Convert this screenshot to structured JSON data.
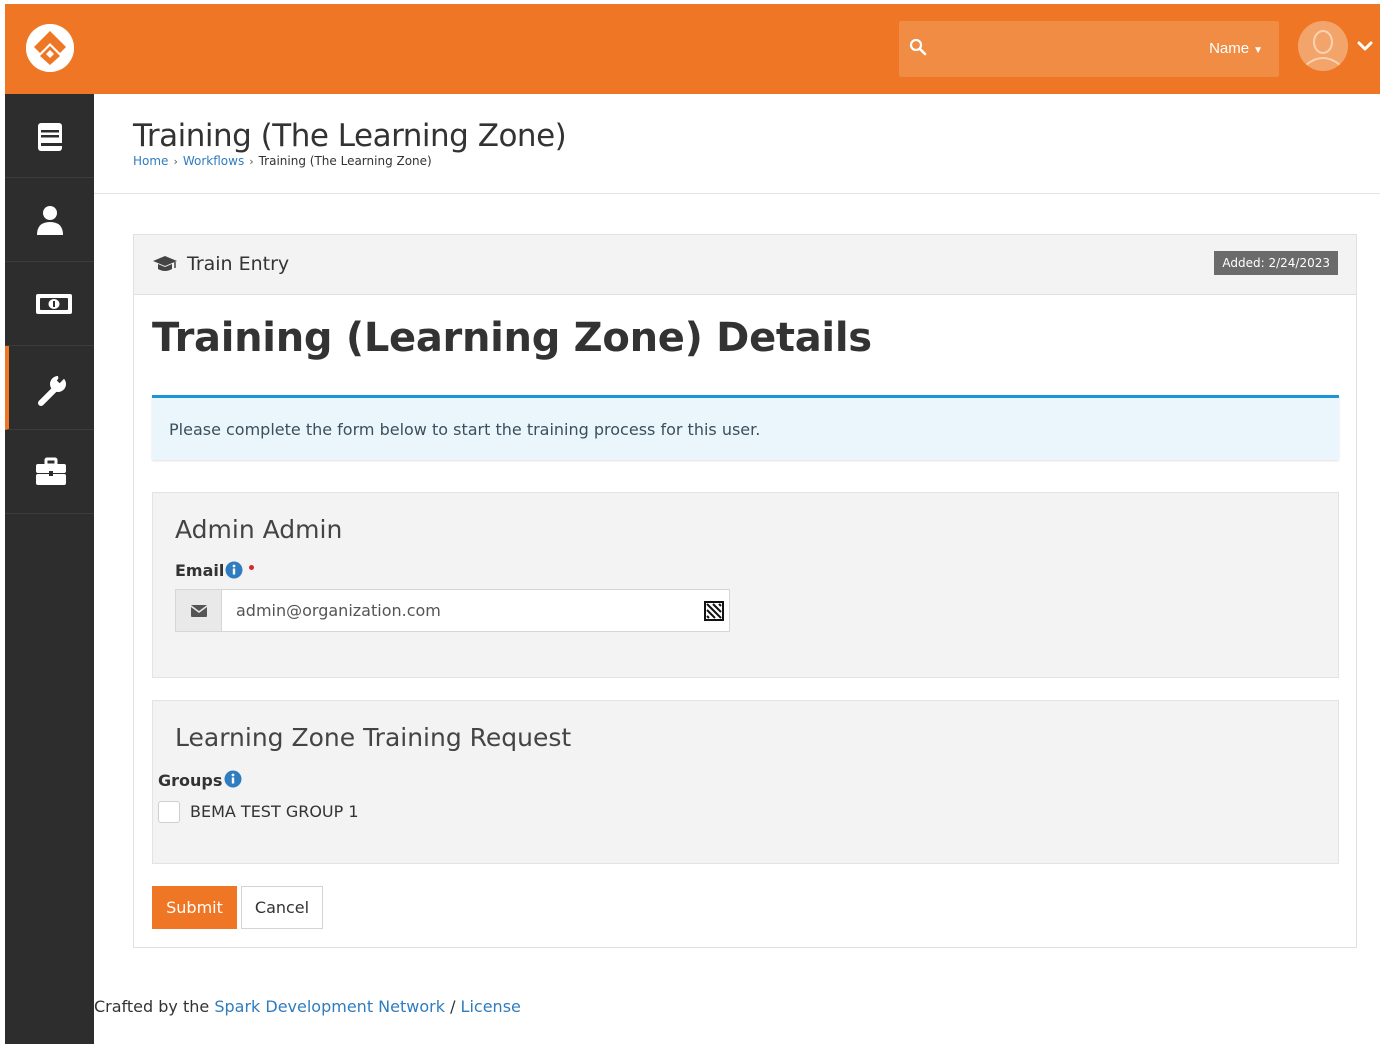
{
  "topbar": {
    "logo": "rock-logo",
    "search_placeholder": "",
    "search_type_label": "Name",
    "avatar_icon": "person-silhouette-icon",
    "accent_color": "#ee7624"
  },
  "sidebar": {
    "items": [
      {
        "icon": "book-icon",
        "active": false
      },
      {
        "icon": "person-icon",
        "active": false
      },
      {
        "icon": "money-icon",
        "active": false
      },
      {
        "icon": "wrench-icon",
        "active": true
      },
      {
        "icon": "briefcase-icon",
        "active": false
      }
    ]
  },
  "page": {
    "title": "Training (The Learning Zone)",
    "breadcrumb": {
      "home": "Home",
      "sep1": "›",
      "workflows": "Workflows",
      "sep2": "›",
      "current": "Training (The Learning Zone)"
    }
  },
  "panel": {
    "title": "Train Entry",
    "title_icon": "graduation-cap-icon",
    "added_badge": "Added: 2/24/2023",
    "form_heading": "Training (Learning Zone) Details",
    "alert_text": "Please complete the form below to start the training process for this user.",
    "section1": {
      "title": "Admin Admin",
      "email_label": "Email",
      "email_value": "admin@organization.com"
    },
    "section2": {
      "title": "Learning Zone Training Request",
      "groups_label": "Groups",
      "checkbox_label": "BEMA TEST GROUP 1",
      "checkbox_checked": false
    },
    "submit_label": "Submit",
    "cancel_label": "Cancel"
  },
  "footer": {
    "prefix": "Crafted by the ",
    "link1": "Spark Development Network",
    "separator": " / ",
    "link2": "License"
  }
}
